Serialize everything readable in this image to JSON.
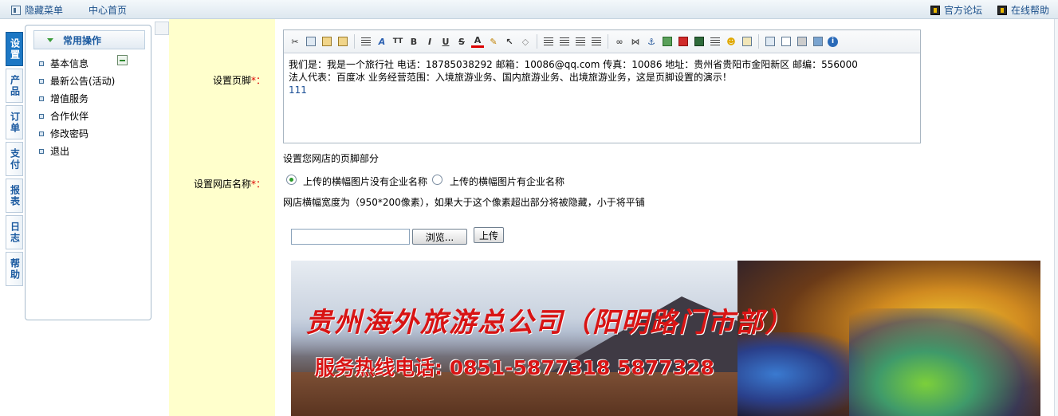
{
  "topbar": {
    "hide_menu": "隐藏菜单",
    "home": "中心首页",
    "forum": "官方论坛",
    "help": "在线帮助"
  },
  "vtabs": [
    "设置",
    "产品",
    "订单",
    "支付",
    "报表",
    "日志",
    "帮助"
  ],
  "sidebar": {
    "header": "常用操作",
    "items": [
      "基本信息",
      "最新公告(活动)",
      "增值服务",
      "合作伙伴",
      "修改密码",
      "退出"
    ]
  },
  "form": {
    "footer_label": "设置页脚",
    "footer_required": "*：",
    "footer_content": {
      "line1": "我们是：我是一个旅行社  电话：18785038292  邮箱：10086@qq.com   传真：10086  地址：贵州省贵阳市金阳新区 邮编：556000",
      "line2": " 法人代表：百度冰   业务经营范围：入境旅游业务、国内旅游业务、出境旅游业务，这是页脚设置的演示！",
      "line3": "111"
    },
    "footer_hint": "设置您网店的页脚部分",
    "shop_name_label": "设置网店名称",
    "shop_name_required": "*：",
    "radio_no_name": "上传的横幅图片没有企业名称",
    "radio_has_name": "上传的横幅图片有企业名称",
    "banner_hint": "网店横幅宽度为（950*200像素），如果大于这个像素超出部分将被隐藏，小于将平铺",
    "browse_button": "浏览...",
    "upload_button": "上传"
  },
  "banner": {
    "title": "贵州海外旅游总公司（阳明路门市部）",
    "phone": "服务热线电话: 0851-5877318  5877328"
  },
  "colors": {
    "label_column": "#ffffcc",
    "active_tab": "#1c77c4",
    "banner_text": "#d81414",
    "required": "#dd0000"
  }
}
